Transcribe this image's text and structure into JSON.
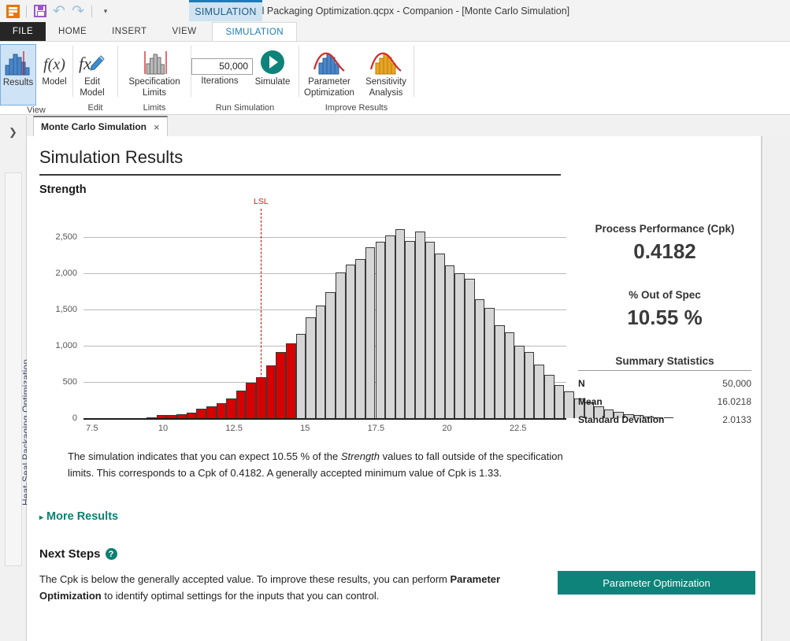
{
  "window": {
    "title": "Heat-Seal Packaging Optimization.qcpx - Companion - [Monte Carlo Simulation]",
    "context_tab": "SIMULATION",
    "quick_access": [
      {
        "name": "app-menu-icon",
        "label": "app-menu-icon"
      },
      {
        "name": "save-icon",
        "label": "save-icon"
      },
      {
        "name": "undo-icon",
        "label": "↶"
      },
      {
        "name": "redo-icon",
        "label": "↷"
      },
      {
        "name": "customize-qat-icon",
        "label": "▾"
      }
    ]
  },
  "ribbon": {
    "tabs": [
      {
        "label": "FILE",
        "active": false,
        "style": "file"
      },
      {
        "label": "HOME",
        "active": false
      },
      {
        "label": "INSERT",
        "active": false
      },
      {
        "label": "VIEW",
        "active": false
      },
      {
        "label": "SIMULATION",
        "active": true
      }
    ],
    "groups": [
      {
        "label": "View",
        "buttons": [
          {
            "label": "Results",
            "icon": "histogram-blue-icon",
            "selected": true
          },
          {
            "label": "Model",
            "icon": "fx-italic-icon",
            "selected": false
          }
        ]
      },
      {
        "label": "Edit",
        "buttons": [
          {
            "label": "Edit\nModel",
            "icon": "fx-pencil-icon",
            "dropdown": true
          }
        ]
      },
      {
        "label": "Limits",
        "buttons": [
          {
            "label": "Specification\nLimits",
            "icon": "spec-limits-icon"
          }
        ]
      },
      {
        "label": "Run Simulation",
        "iterations_value": "50,000",
        "iterations_label": "Iterations",
        "buttons": [
          {
            "label": "Simulate",
            "icon": "play-circle-icon"
          }
        ]
      },
      {
        "label": "Improve Results",
        "buttons": [
          {
            "label": "Parameter\nOptimization",
            "icon": "param-optimization-icon"
          },
          {
            "label": "Sensitivity\nAnalysis",
            "icon": "sensitivity-analysis-icon"
          }
        ]
      }
    ]
  },
  "rail": {
    "expand_icon": "❯",
    "project_label": "Heat-Seal Packaging Optimization"
  },
  "doc_tab": {
    "label": "Monte Carlo Simulation",
    "close": "×"
  },
  "main": {
    "page_title": "Simulation Results",
    "variable_title": "Strength",
    "interpretation_parts": [
      {
        "text": "The simulation indicates that you can expect 10.55 % of the ",
        "style": "normal"
      },
      {
        "text": "Strength",
        "style": "italic"
      },
      {
        "text": " values to fall outside of the specification limits. This corresponds to a Cpk of 0.4182. A generally accepted minimum value of Cpk is 1.33.",
        "style": "normal"
      }
    ],
    "more_results_label": "More Results",
    "more_results_triangle": "▸",
    "next_steps_heading": "Next Steps",
    "next_steps_help": "?",
    "next_steps_parts": [
      {
        "text": "The Cpk is below the generally accepted value. To improve these results, you can perform ",
        "style": "normal"
      },
      {
        "text": "Parameter Optimization",
        "style": "bold"
      },
      {
        "text": " to identify optimal settings for the inputs that you can control.",
        "style": "normal"
      }
    ],
    "primary_button": "Parameter Optimization"
  },
  "stats": {
    "cpk_label": "Process Performance (Cpk)",
    "cpk_value": "0.4182",
    "oos_label": "% Out of Spec",
    "oos_value": "10.55 %",
    "summary_heading": "Summary Statistics",
    "summary_rows": [
      {
        "key": "N",
        "value": "50,000"
      },
      {
        "key": "Mean",
        "value": "16.0218"
      },
      {
        "key": "Standard Deviation",
        "value": "2.0133"
      }
    ]
  },
  "colors": {
    "accent_teal": "#0e8379",
    "out_of_spec_red": "#d80000",
    "in_spec_gray": "#d6d6d6",
    "lsl_red": "#c00000",
    "ribbon_selected": "#cfe3f7",
    "context_tab_blue": "#1d7bb8"
  },
  "chart_data": {
    "type": "bar",
    "title": "Strength",
    "xlabel": "",
    "ylabel": "",
    "grid": true,
    "legend": null,
    "xlim": [
      7.2,
      24.2
    ],
    "ylim": [
      0,
      2700
    ],
    "ytick_labels": [
      "0",
      "500",
      "1,000",
      "1,500",
      "2,000",
      "2,500"
    ],
    "ytick_values": [
      0,
      500,
      1000,
      1500,
      2000,
      2500
    ],
    "xtick_labels": [
      "7.5",
      "10",
      "12.5",
      "15",
      "17.5",
      "20",
      "22.5"
    ],
    "xtick_values": [
      7.5,
      10,
      12.5,
      15,
      17.5,
      20,
      22.5
    ],
    "bin_width": 0.35,
    "annotations": [
      {
        "name": "LSL",
        "label": "LSL",
        "x": 13.45,
        "style": "dashed-vertical-red"
      }
    ],
    "bins": [
      {
        "x": 9.6,
        "value": 12,
        "out_of_spec": true
      },
      {
        "x": 9.95,
        "value": 40,
        "out_of_spec": true
      },
      {
        "x": 10.3,
        "value": 45,
        "out_of_spec": true
      },
      {
        "x": 10.65,
        "value": 52,
        "out_of_spec": true
      },
      {
        "x": 11.0,
        "value": 72,
        "out_of_spec": true
      },
      {
        "x": 11.35,
        "value": 130,
        "out_of_spec": true
      },
      {
        "x": 11.7,
        "value": 165,
        "out_of_spec": true
      },
      {
        "x": 12.05,
        "value": 205,
        "out_of_spec": true
      },
      {
        "x": 12.4,
        "value": 270,
        "out_of_spec": true
      },
      {
        "x": 12.75,
        "value": 385,
        "out_of_spec": true
      },
      {
        "x": 13.1,
        "value": 490,
        "out_of_spec": true
      },
      {
        "x": 13.45,
        "value": 570,
        "out_of_spec": true
      },
      {
        "x": 13.8,
        "value": 725,
        "out_of_spec": true
      },
      {
        "x": 14.15,
        "value": 920,
        "out_of_spec": true
      },
      {
        "x": 14.5,
        "value": 1030,
        "out_of_spec": true
      },
      {
        "x": 14.85,
        "value": 1165,
        "out_of_spec": false
      },
      {
        "x": 15.2,
        "value": 1395,
        "out_of_spec": false
      },
      {
        "x": 15.55,
        "value": 1560,
        "out_of_spec": false
      },
      {
        "x": 15.9,
        "value": 1745,
        "out_of_spec": false
      },
      {
        "x": 16.25,
        "value": 2015,
        "out_of_spec": false
      },
      {
        "x": 16.6,
        "value": 2120,
        "out_of_spec": false
      },
      {
        "x": 16.95,
        "value": 2195,
        "out_of_spec": false
      },
      {
        "x": 17.3,
        "value": 2360,
        "out_of_spec": false
      },
      {
        "x": 17.65,
        "value": 2440,
        "out_of_spec": false
      },
      {
        "x": 18.0,
        "value": 2530,
        "out_of_spec": false
      },
      {
        "x": 18.35,
        "value": 2610,
        "out_of_spec": false
      },
      {
        "x": 18.7,
        "value": 2450,
        "out_of_spec": false
      },
      {
        "x": 19.05,
        "value": 2580,
        "out_of_spec": false
      },
      {
        "x": 19.4,
        "value": 2440,
        "out_of_spec": false
      },
      {
        "x": 19.75,
        "value": 2280,
        "out_of_spec": false
      },
      {
        "x": 20.1,
        "value": 2110,
        "out_of_spec": false
      },
      {
        "x": 20.45,
        "value": 2005,
        "out_of_spec": false
      },
      {
        "x": 20.8,
        "value": 1930,
        "out_of_spec": false
      },
      {
        "x": 21.15,
        "value": 1640,
        "out_of_spec": false
      },
      {
        "x": 21.5,
        "value": 1520,
        "out_of_spec": false
      },
      {
        "x": 21.85,
        "value": 1290,
        "out_of_spec": false
      },
      {
        "x": 22.2,
        "value": 1190,
        "out_of_spec": false
      },
      {
        "x": 22.55,
        "value": 1000,
        "out_of_spec": false
      },
      {
        "x": 22.9,
        "value": 915,
        "out_of_spec": false
      },
      {
        "x": 23.25,
        "value": 740,
        "out_of_spec": false
      },
      {
        "x": 23.6,
        "value": 600,
        "out_of_spec": false
      },
      {
        "x": 23.95,
        "value": 460,
        "out_of_spec": false
      },
      {
        "x": 24.3,
        "value": 370,
        "out_of_spec": false
      },
      {
        "x": 24.65,
        "value": 275,
        "out_of_spec": false
      },
      {
        "x": 25.0,
        "value": 215,
        "out_of_spec": false
      },
      {
        "x": 25.35,
        "value": 160,
        "out_of_spec": false
      },
      {
        "x": 25.7,
        "value": 120,
        "out_of_spec": false
      },
      {
        "x": 26.05,
        "value": 85,
        "out_of_spec": false
      },
      {
        "x": 26.4,
        "value": 60,
        "out_of_spec": false
      },
      {
        "x": 26.75,
        "value": 40,
        "out_of_spec": false
      },
      {
        "x": 27.1,
        "value": 25,
        "out_of_spec": false
      },
      {
        "x": 27.45,
        "value": 15,
        "out_of_spec": false
      },
      {
        "x": 27.8,
        "value": 8,
        "out_of_spec": false
      }
    ]
  }
}
